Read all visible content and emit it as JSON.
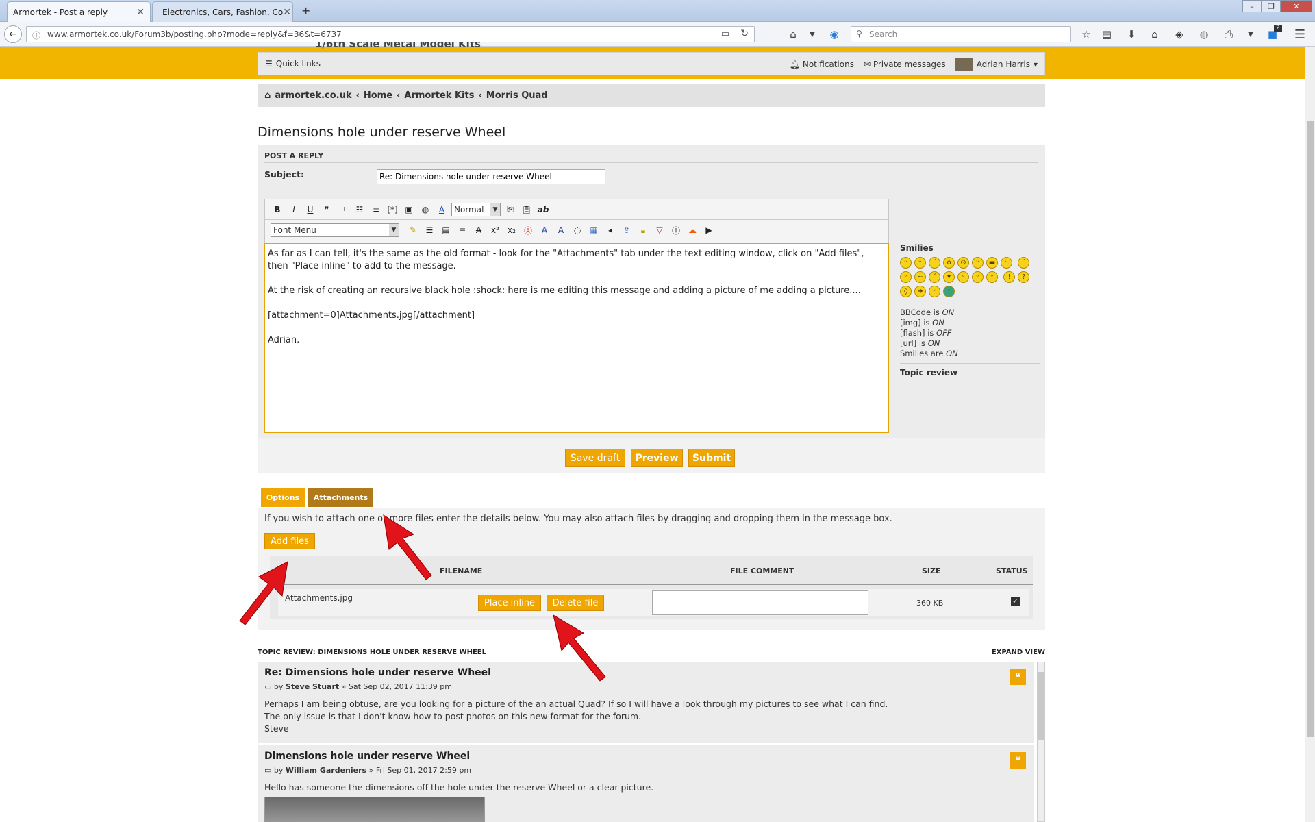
{
  "browser": {
    "tabs": [
      {
        "label": "Armortek - Post a reply"
      },
      {
        "label": "Electronics, Cars, Fashion, Co"
      }
    ],
    "new_tab": "+",
    "url": "www.armortek.co.uk/Forum3b/posting.php?mode=reply&f=36&t=6737",
    "search_placeholder": "Search",
    "notification_count": "2"
  },
  "site": {
    "truncated_heading": "1/6th Scale Metal Model Kits",
    "quick_links": "Quick links",
    "notifications": "Notifications",
    "private_messages": "Private messages",
    "user": "Adrian Harris",
    "breadcrumbs": [
      "armortek.co.uk",
      "Home",
      "Armortek Kits",
      "Morris Quad"
    ],
    "crumb_sep": "‹"
  },
  "topic_title": "Dimensions hole under reserve Wheel",
  "form": {
    "header": "POST A REPLY",
    "subject_label": "Subject:",
    "subject_value": "Re: Dimensions hole under reserve Wheel",
    "size_select": "Normal",
    "font_menu": "Font Menu",
    "message_lines": [
      "As far as I can tell, it's the same as the old format - look for the \"Attachments\" tab under the text editing window, click on \"Add files\", then \"Place inline\" to add to the message.",
      "At the risk of creating an recursive black hole  :shock:  here is me editing this message and adding a picture of me adding a picture....",
      "[attachment=0]Attachments.jpg[/attachment]",
      "Adrian."
    ],
    "smilies_label": "Smilies",
    "bbcode_status": [
      {
        "label": "BBCode is ",
        "state": "ON"
      },
      {
        "label": "[img] is ",
        "state": "ON"
      },
      {
        "label": "[flash] is ",
        "state": "OFF"
      },
      {
        "label": "[url] is ",
        "state": "ON"
      },
      {
        "label": "Smilies are ",
        "state": "ON"
      }
    ],
    "topic_review_link": "Topic review",
    "buttons": {
      "save_draft": "Save draft",
      "preview": "Preview",
      "submit": "Submit"
    }
  },
  "attachments": {
    "tab_options": "Options",
    "tab_attachments": "Attachments",
    "help": "If you wish to attach one or more files enter the details below. You may also attach files by dragging and dropping them in the message box.",
    "add_files": "Add files",
    "columns": {
      "filename": "FILENAME",
      "comment": "FILE COMMENT",
      "size": "SIZE",
      "status": "STATUS"
    },
    "file": {
      "name": "Attachments.jpg",
      "place_inline": "Place inline",
      "delete": "Delete file",
      "size": "360 KB"
    }
  },
  "review": {
    "heading": "TOPIC REVIEW: DIMENSIONS HOLE UNDER RESERVE WHEEL",
    "expand": "EXPAND VIEW",
    "posts": [
      {
        "title": "Re: Dimensions hole under reserve Wheel",
        "by": "by",
        "author": "Steve Stuart",
        "date": "» Sat Sep 02, 2017 11:39 pm",
        "lines": [
          "Perhaps I am being obtuse, are you looking for a picture of the an actual Quad? If so I will have a look through my pictures to see what I can find.",
          "The only issue is that I don't know how to post photos on this new format for the forum.",
          "Steve"
        ]
      },
      {
        "title": "Dimensions hole under reserve Wheel",
        "by": "by",
        "author": "William Gardeniers",
        "date": "» Fri Sep 01, 2017 2:59 pm",
        "lines": [
          "Hello has someone the dimensions off the hole under the reserve Wheel or a clear picture."
        ]
      }
    ]
  },
  "colors": {
    "brand_yellow": "#f1b500",
    "button_orange": "#f0a600",
    "arrow_red": "#e0141a"
  }
}
